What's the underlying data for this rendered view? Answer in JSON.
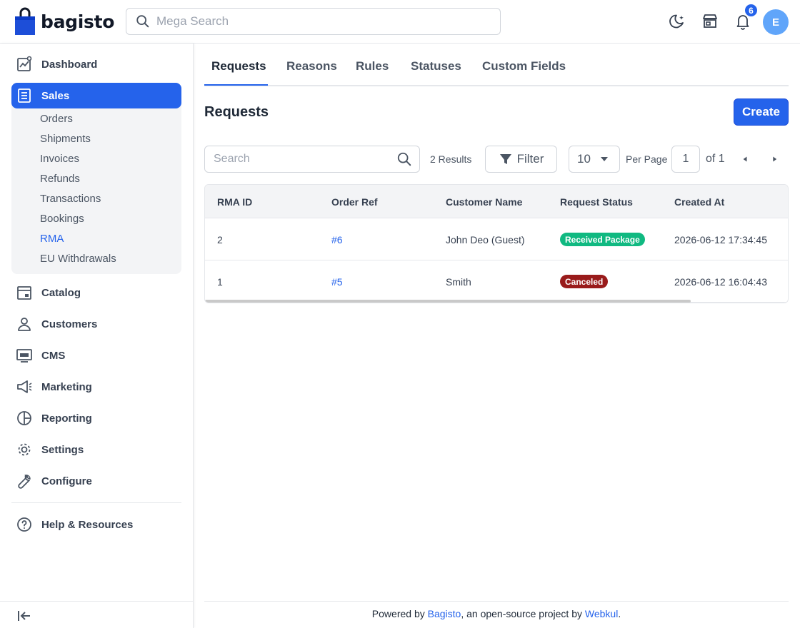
{
  "header": {
    "brand": "bagisto",
    "search_placeholder": "Mega Search",
    "notification_count": "6",
    "avatar_initial": "E",
    "icons": [
      "moon-icon",
      "storefront-icon",
      "bell-icon"
    ]
  },
  "sidebar": {
    "items": [
      {
        "label": "Dashboard",
        "icon": "dashboard-icon"
      },
      {
        "label": "Sales",
        "icon": "sales-icon",
        "active": true
      },
      {
        "label": "Catalog",
        "icon": "catalog-icon"
      },
      {
        "label": "Customers",
        "icon": "customers-icon"
      },
      {
        "label": "CMS",
        "icon": "cms-icon"
      },
      {
        "label": "Marketing",
        "icon": "megaphone-icon"
      },
      {
        "label": "Reporting",
        "icon": "pie-chart-icon"
      },
      {
        "label": "Settings",
        "icon": "gear-icon"
      },
      {
        "label": "Configure",
        "icon": "wrench-icon"
      },
      {
        "label": "Help & Resources",
        "icon": "help-circle-icon"
      }
    ],
    "sales_children": [
      "Orders",
      "Shipments",
      "Invoices",
      "Refunds",
      "Transactions",
      "Bookings",
      "RMA",
      "EU Withdrawals"
    ],
    "active_child": "RMA"
  },
  "tabs": [
    "Requests",
    "Reasons",
    "Rules",
    "Statuses",
    "Custom Fields"
  ],
  "page": {
    "title": "Requests",
    "create_label": "Create"
  },
  "toolbar": {
    "search_placeholder": "Search",
    "results": "2 Results",
    "filter_label": "Filter",
    "per_page_value": "10",
    "per_page_label": "Per Page",
    "page_number": "1",
    "page_of": "of 1"
  },
  "table": {
    "columns": [
      "RMA ID",
      "Order Ref",
      "Customer Name",
      "Request Status",
      "Created At"
    ],
    "rows": [
      {
        "rma_id": "2",
        "order_ref": "#6",
        "customer": "John Deo (Guest)",
        "status": "Received Package",
        "status_color": "#10b981",
        "created_at": "2026-06-12 17:34:45"
      },
      {
        "rma_id": "1",
        "order_ref": "#5",
        "customer": "Smith",
        "status": "Canceled",
        "status_color": "#991b1b",
        "created_at": "2026-06-12 16:04:43"
      }
    ]
  },
  "footer": {
    "prefix": "Powered by ",
    "brand_link": "Bagisto",
    "middle": ", an open-source project by ",
    "company_link": "Webkul",
    "suffix": "."
  },
  "colors": {
    "accent": "#2563eb",
    "status_received": "#10b981",
    "status_canceled": "#991b1b"
  }
}
